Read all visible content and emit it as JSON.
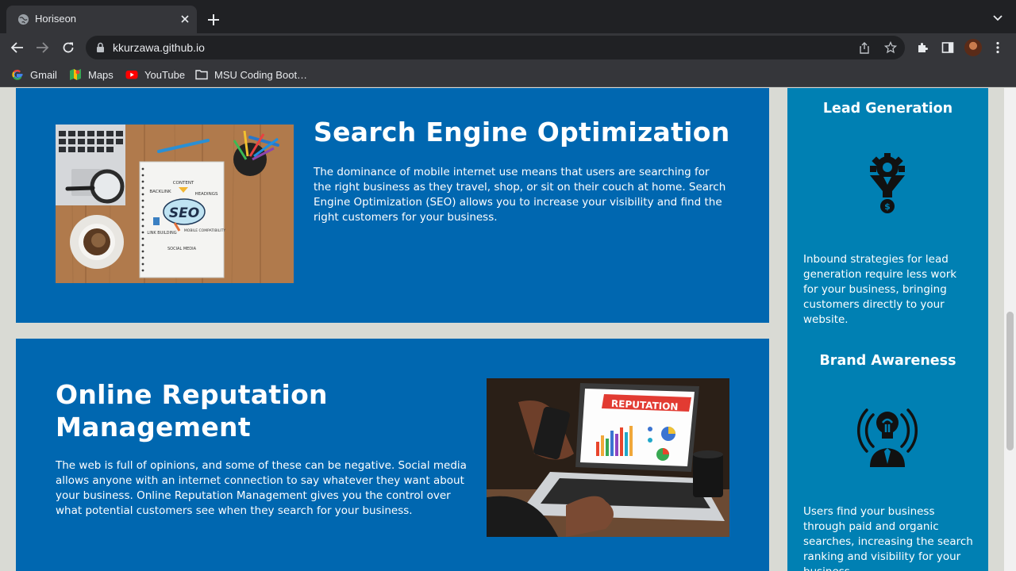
{
  "browser": {
    "tab": {
      "title": "Horiseon"
    },
    "url": "kkurzawa.github.io",
    "bookmarks": [
      {
        "label": "Gmail",
        "icon": "google-icon"
      },
      {
        "label": "Maps",
        "icon": "maps-icon"
      },
      {
        "label": "YouTube",
        "icon": "youtube-icon"
      },
      {
        "label": "MSU Coding Boot…",
        "icon": "folder-icon"
      }
    ]
  },
  "main": {
    "seo": {
      "title": "Search Engine Optimization",
      "text": "The dominance of mobile internet use means that users are searching for the right business as they travel, shop, or sit on their couch at home. Search Engine Optimization (SEO) allows you to increase your visibility and find the right customers for your business.",
      "image_labels": {
        "center": "SEO",
        "content": "CONTENT",
        "headings": "HEADINGS",
        "backlink": "BACKLINK",
        "mobile": "MOBILE COMPATIBILITY",
        "link": "LINK BUILDING",
        "social": "SOCIAL MEDIA"
      }
    },
    "orm": {
      "title": "Online Reputation Management",
      "text": "The web is full of opinions, and some of these can be negative. Social media allows anyone with an internet connection to say whatever they want about your business. Online Reputation Management gives you the control over what potential customers see when they search for your business.",
      "image_label": "REPUTATION"
    }
  },
  "sidebar": {
    "lead": {
      "title": "Lead Generation",
      "text": "Inbound strategies for lead generation require less work for your business, bringing customers directly to your website."
    },
    "brand": {
      "title": "Brand Awareness",
      "text": "Users find your business through paid and organic searches, increasing the search ranking and visibility for your business."
    }
  },
  "colors": {
    "card": "#0067b0",
    "sidebar": "#0080b3",
    "page_bg": "#d9dad4"
  }
}
